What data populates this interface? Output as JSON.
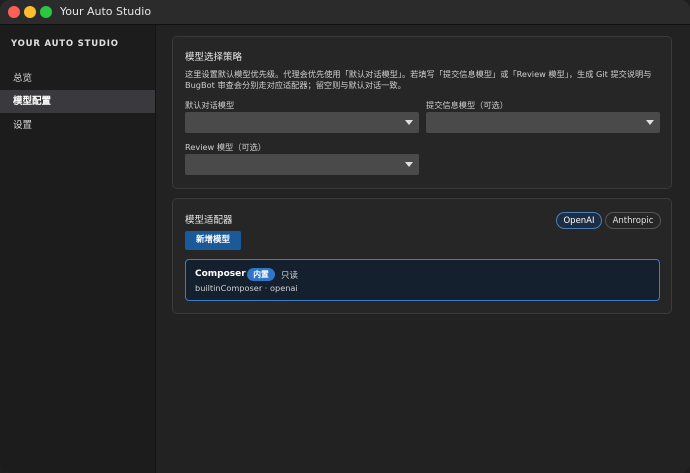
{
  "window": {
    "title": "Your Auto Studio"
  },
  "sidebar": {
    "brand": "YOUR AUTO STUDIO",
    "items": [
      {
        "label": "总览",
        "active": false
      },
      {
        "label": "模型配置",
        "active": true
      },
      {
        "label": "设置",
        "active": false
      }
    ]
  },
  "strategy": {
    "title": "模型选择策略",
    "description": "这里设置默认模型优先级。代理会优先使用「默认对话模型」。若填写「提交信息模型」或「Review 模型」，生成 Git 提交说明与 BugBot 审查会分别走对应适配器；留空则与默认对话一致。",
    "default_label": "默认对话模型",
    "default_value": "",
    "commit_label": "提交信息模型（可选）",
    "commit_value": "",
    "review_label": "Review 模型（可选）",
    "review_value": ""
  },
  "adapters": {
    "title": "模型适配器",
    "tabs": [
      {
        "label": "OpenAI",
        "active": true
      },
      {
        "label": "Anthropic",
        "active": false
      }
    ],
    "add_button": "新增模型",
    "models": [
      {
        "name": "Composer",
        "badge": "内置",
        "readonly": "只读",
        "meta": "builtinComposer · openai"
      }
    ]
  },
  "colors": {
    "accent": "#1a5a98",
    "badge": "#2f76c8",
    "selected_border": "#3f7cc4"
  }
}
